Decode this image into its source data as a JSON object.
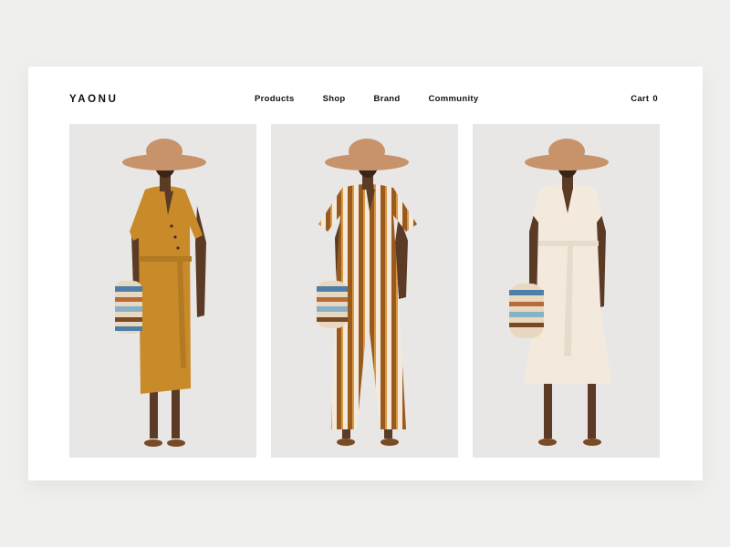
{
  "brand": {
    "logo": "YAONU"
  },
  "nav": {
    "items": [
      "Products",
      "Shop",
      "Brand",
      "Community"
    ]
  },
  "cart": {
    "label": "Cart",
    "count": "0"
  },
  "colors": {
    "page_bg": "#efefed",
    "card_bg": "#ffffff",
    "photo_bg": "#e8e7e5",
    "mustard": "#c98a2a",
    "cream": "#f3eadd",
    "stripe_brown": "#9a5a1e",
    "hat": "#c8936a"
  },
  "products": [
    {
      "name": "mustard-wrap-dress"
    },
    {
      "name": "striped-jumpsuit"
    },
    {
      "name": "cream-belted-dress"
    }
  ]
}
